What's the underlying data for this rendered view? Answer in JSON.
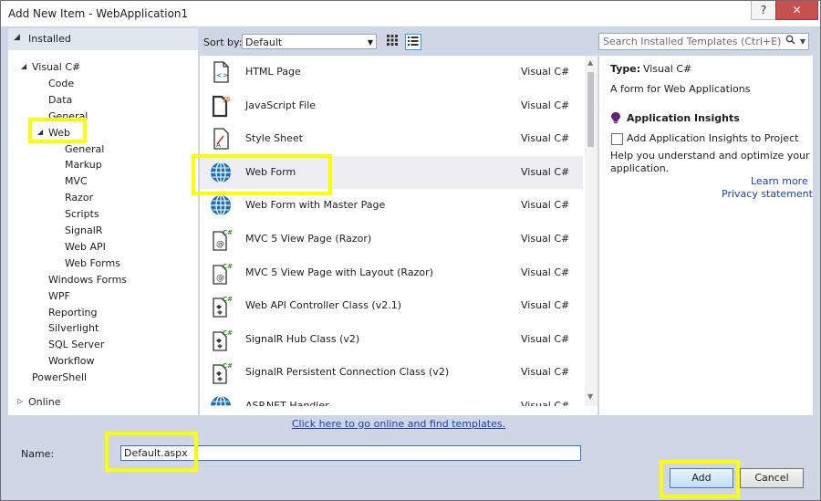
{
  "window": {
    "title": "Add New Item - WebApplication1",
    "help": "?",
    "close": "✕"
  },
  "left": {
    "installed": "Installed",
    "tree": [
      {
        "label": "Visual C#",
        "level": 0,
        "expanded": true
      },
      {
        "label": "Code",
        "level": 1
      },
      {
        "label": "Data",
        "level": 1
      },
      {
        "label": "General",
        "level": 1
      },
      {
        "label": "Web",
        "level": 1,
        "expanded": true
      },
      {
        "label": "General",
        "level": 2
      },
      {
        "label": "Markup",
        "level": 2
      },
      {
        "label": "MVC",
        "level": 2
      },
      {
        "label": "Razor",
        "level": 2
      },
      {
        "label": "Scripts",
        "level": 2
      },
      {
        "label": "SignalR",
        "level": 2
      },
      {
        "label": "Web API",
        "level": 2
      },
      {
        "label": "Web Forms",
        "level": 2
      },
      {
        "label": "Windows Forms",
        "level": 1
      },
      {
        "label": "WPF",
        "level": 1
      },
      {
        "label": "Reporting",
        "level": 1
      },
      {
        "label": "Silverlight",
        "level": 1
      },
      {
        "label": "SQL Server",
        "level": 1
      },
      {
        "label": "Workflow",
        "level": 1
      },
      {
        "label": "PowerShell",
        "level": 0
      }
    ],
    "online": "Online"
  },
  "toolbar": {
    "sort_label": "Sort by:",
    "sort_value": "Default",
    "search_placeholder": "Search Installed Templates (Ctrl+E)"
  },
  "templates": [
    {
      "name": "HTML Page",
      "lang": "Visual C#",
      "icon": "html-page-icon"
    },
    {
      "name": "JavaScript File",
      "lang": "Visual C#",
      "icon": "javascript-file-icon"
    },
    {
      "name": "Style Sheet",
      "lang": "Visual C#",
      "icon": "style-sheet-icon"
    },
    {
      "name": "Web Form",
      "lang": "Visual C#",
      "icon": "web-form-globe-icon",
      "selected": true
    },
    {
      "name": "Web Form with Master Page",
      "lang": "Visual C#",
      "icon": "web-form-globe-icon"
    },
    {
      "name": "MVC 5 View Page (Razor)",
      "lang": "Visual C#",
      "icon": "mvc-view-page-icon"
    },
    {
      "name": "MVC 5 View Page with Layout (Razor)",
      "lang": "Visual C#",
      "icon": "mvc-view-page-icon"
    },
    {
      "name": "Web API Controller Class (v2.1)",
      "lang": "Visual C#",
      "icon": "csharp-class-icon"
    },
    {
      "name": "SignalR Hub Class (v2)",
      "lang": "Visual C#",
      "icon": "csharp-class-icon"
    },
    {
      "name": "SignalR Persistent Connection Class (v2)",
      "lang": "Visual C#",
      "icon": "csharp-class-icon"
    },
    {
      "name": "ASP.NET Handler",
      "lang": "Visual C#",
      "icon": "web-form-globe-icon"
    }
  ],
  "online_link": "Click here to go online and find templates.",
  "details": {
    "type_label": "Type:",
    "type_value": "Visual C#",
    "description": "A form for Web Applications",
    "ai_title": "Application Insights",
    "ai_checkbox": "Add Application Insights to Project",
    "ai_help_1": "Help you understand and optimize your",
    "ai_help_2": "application.",
    "learn_more": "Learn more",
    "privacy": "Privacy statement"
  },
  "bottom": {
    "name_label": "Name:",
    "name_value": "Default.aspx",
    "add": "Add",
    "cancel": "Cancel"
  },
  "colors": {
    "highlight": "#ffff00",
    "accent": "#3399ff",
    "link": "#1a3fb0"
  }
}
